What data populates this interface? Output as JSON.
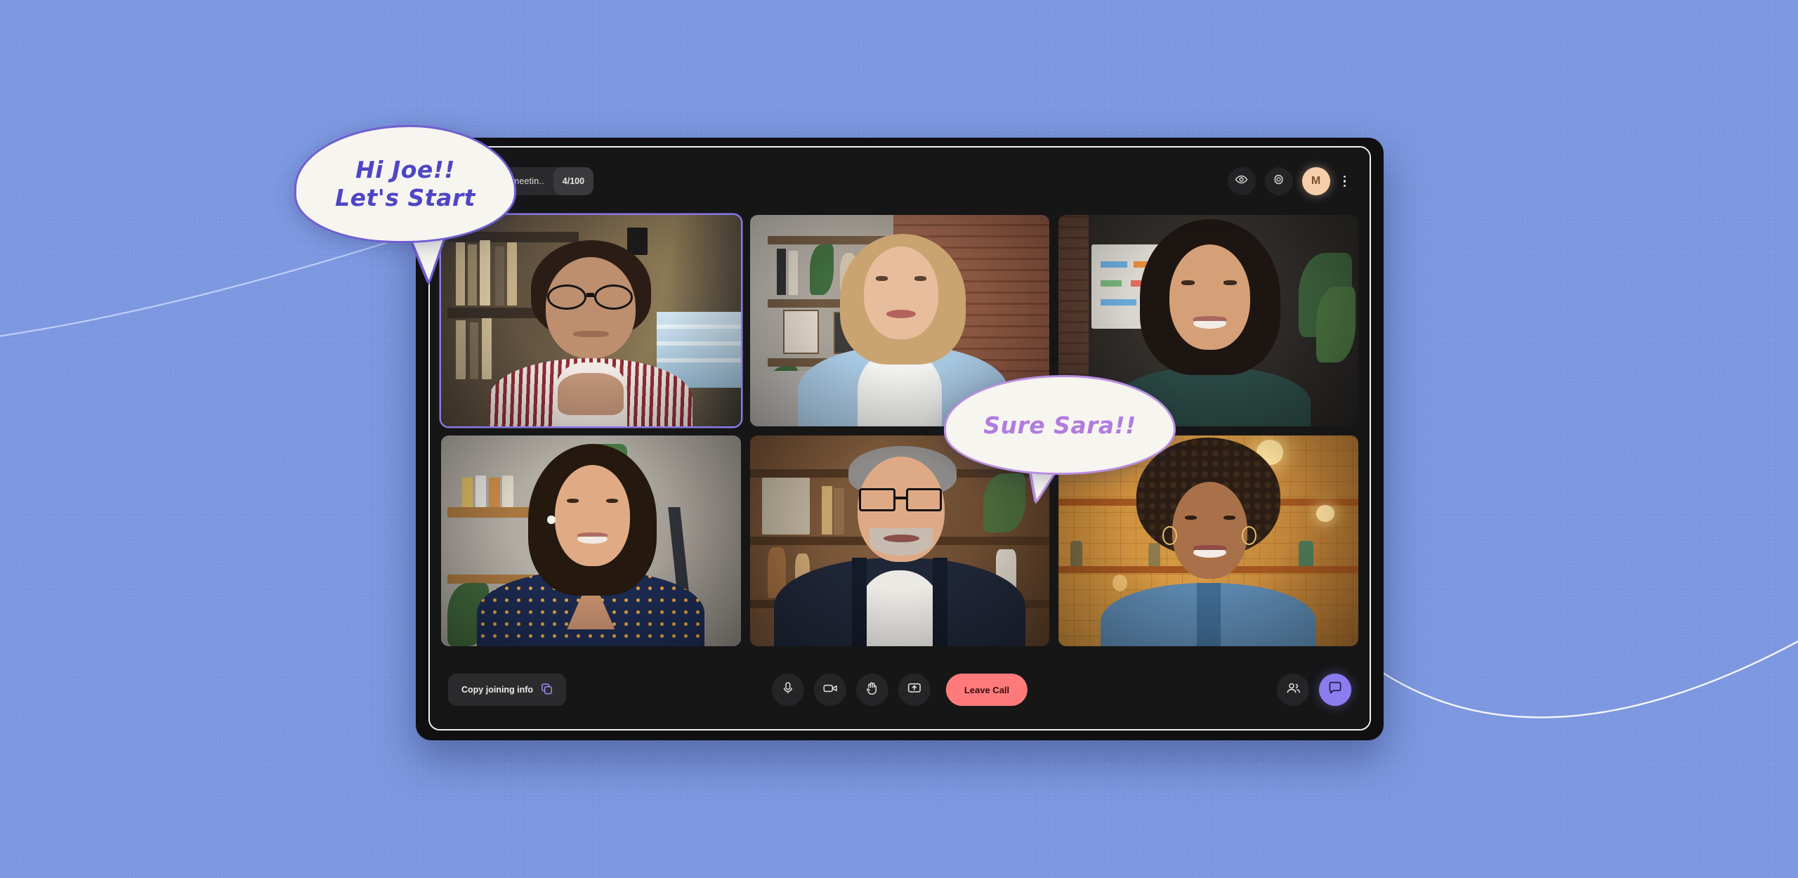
{
  "background": {
    "color": "#7e99e2",
    "accent_line_color": "#ffffff"
  },
  "colors": {
    "accent_purple": "#8b7cf0",
    "active_speaker_border": "#8a7ae8",
    "leave_call_bg": "#ff7b7b",
    "leave_call_text": "#3a0d0d",
    "avatar_bg": "#f6cfaa",
    "panel_bg": "#161617",
    "bubble_1_text": "#4e46c4",
    "bubble_2_text": "#b07ce0"
  },
  "header": {
    "lock_icon": "lock-icon",
    "meeting_name": "marthas_meetin..",
    "capacity_badge": "4/100",
    "actions": [
      {
        "name": "eye-icon",
        "label": "View"
      },
      {
        "name": "gear-icon",
        "label": "Settings"
      }
    ],
    "avatar_initial": "M",
    "kebab_icon": "more-vertical-icon"
  },
  "grid": {
    "participants": [
      {
        "id": "p1",
        "active": true,
        "name": "participant-tile-1"
      },
      {
        "id": "p2",
        "active": false,
        "name": "participant-tile-2"
      },
      {
        "id": "p3",
        "active": false,
        "name": "participant-tile-3"
      },
      {
        "id": "p4",
        "active": false,
        "name": "participant-tile-4"
      },
      {
        "id": "p5",
        "active": false,
        "name": "participant-tile-5"
      },
      {
        "id": "p6",
        "active": false,
        "name": "participant-tile-6"
      }
    ]
  },
  "controls": {
    "copy_label": "Copy joining info",
    "copy_icon": "copy-icon",
    "center": [
      {
        "icon": "microphone-icon",
        "label": "Mute"
      },
      {
        "icon": "video-camera-icon",
        "label": "Camera"
      },
      {
        "icon": "raise-hand-icon",
        "label": "Raise hand"
      },
      {
        "icon": "screen-share-icon",
        "label": "Share screen"
      }
    ],
    "leave_label": "Leave Call",
    "right": [
      {
        "icon": "people-icon",
        "label": "Participants"
      },
      {
        "icon": "chat-icon",
        "label": "Chat"
      }
    ]
  },
  "bubbles": [
    {
      "id": "bubble-1",
      "line1": "Hi Joe!!",
      "line2": "Let's Start"
    },
    {
      "id": "bubble-2",
      "line1": "Sure Sara!!",
      "line2": ""
    }
  ]
}
